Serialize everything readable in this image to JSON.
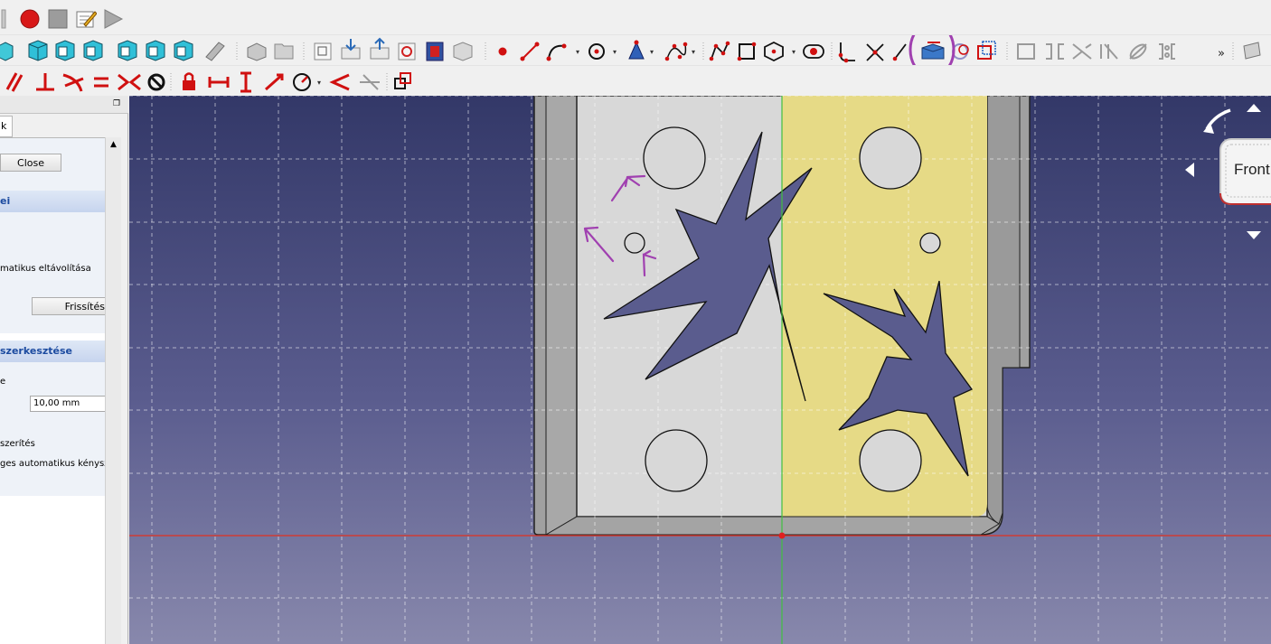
{
  "toolbar_row1": {
    "icons": [
      "record-macro-icon",
      "stop-macro-icon",
      "edit-macro-icon",
      "run-macro-icon"
    ]
  },
  "toolbar_row2": {
    "icons": [
      "fit-all-icon",
      "isometric-view-icon",
      "front-view-icon",
      "top-view-icon",
      "right-view-icon",
      "rear-view-icon",
      "bottom-view-icon",
      "left-view-icon",
      "measure-icon",
      "part-icon",
      "group-icon",
      "new-sketch-icon",
      "attach-sketch-icon",
      "leave-sketch-icon",
      "view-sketch-icon",
      "view-section-icon",
      "map-sketch-icon",
      "point-icon",
      "line-icon",
      "arc-icon",
      "circle-icon",
      "conic-icon",
      "bspline-icon",
      "polyline-icon",
      "rectangle-icon",
      "polygon-icon",
      "slot-icon",
      "fillet-icon",
      "trim-icon",
      "extend-icon",
      "external-geometry-icon",
      "carbon-copy-icon",
      "construction-mode-icon",
      "select-conflicts-icon",
      "symmetry-tool-icon",
      "clone-tool-icon",
      "rectangular-array-icon",
      "mirror-tool-icon",
      "remove-axes-icon",
      "delete-geometry-icon",
      "overflow-icon",
      "more-tools-icon"
    ]
  },
  "toolbar_row3": {
    "icons": [
      "parallel-constraint-icon",
      "perpendicular-constraint-icon",
      "tangent-constraint-icon",
      "equal-constraint-icon",
      "symmetric-constraint-icon",
      "block-constraint-icon",
      "lock-constraint-icon",
      "horizontal-distance-icon",
      "vertical-distance-icon",
      "distance-constraint-icon",
      "radius-constraint-icon",
      "angle-constraint-icon",
      "snell-law-icon",
      "internal-alignment-icon"
    ]
  },
  "panel": {
    "tab_label": "k",
    "close_label": "Close",
    "section1_title": "ei",
    "auto_remove_label": "matikus eltávolítása",
    "refresh_label": "Frissítés",
    "section2_title": "szerkesztése",
    "grid_label": "e",
    "grid_value": "10,00 mm",
    "constraint_label": "szerítés",
    "auto_constraint_label": "ges automatikus kényszer"
  },
  "navcube": {
    "face_label": "Front"
  },
  "colors": {
    "annotation": "#a040b0",
    "sketch_face": "#e6da86",
    "part_face": "#d8d8d8",
    "x_axis": "#e03020",
    "y_axis": "#40c040",
    "background_top": "#333868",
    "background_bottom": "#8888ac"
  }
}
